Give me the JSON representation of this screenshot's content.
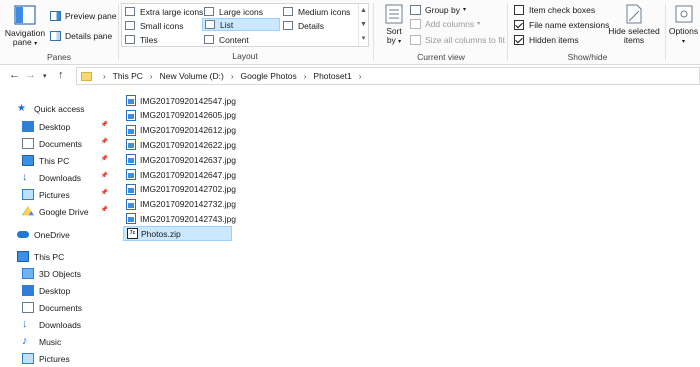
{
  "ribbon": {
    "panes": {
      "group_label": "Panes",
      "navigation_pane_label": "Navigation",
      "navigation_pane_label2": "pane",
      "preview_pane_label": "Preview pane",
      "details_pane_label": "Details pane"
    },
    "layout": {
      "group_label": "Layout",
      "extra_large_icons": "Extra large icons",
      "large_icons": "Large icons",
      "medium_icons": "Medium icons",
      "small_icons": "Small icons",
      "list": "List",
      "details": "Details",
      "tiles": "Tiles",
      "content": "Content",
      "selected": "List"
    },
    "current_view": {
      "group_label": "Current view",
      "sort_by_label": "Sort",
      "sort_by_label2": "by",
      "group_by": "Group by",
      "add_columns": "Add columns",
      "size_all_columns": "Size all columns to fit"
    },
    "show_hide": {
      "group_label": "Show/hide",
      "item_check_boxes": "Item check boxes",
      "item_check_boxes_checked": false,
      "file_name_extensions": "File name extensions",
      "file_name_extensions_checked": true,
      "hidden_items": "Hidden items",
      "hidden_items_checked": true,
      "hide_selected_items": "Hide selected",
      "hide_selected_items2": "items"
    },
    "options": {
      "label": "Options"
    }
  },
  "address_bar": {
    "breadcrumbs": [
      "This PC",
      "New Volume (D:)",
      "Google Photos",
      "Photoset1"
    ]
  },
  "nav_pane": {
    "quick_access": {
      "label": "Quick access",
      "items": [
        {
          "label": "Desktop",
          "icon": "desktop-icon",
          "pinned": true
        },
        {
          "label": "Documents",
          "icon": "documents-icon",
          "pinned": true
        },
        {
          "label": "This PC",
          "icon": "computer-icon",
          "pinned": true
        },
        {
          "label": "Downloads",
          "icon": "downloads-icon",
          "pinned": true
        },
        {
          "label": "Pictures",
          "icon": "pictures-icon",
          "pinned": true
        },
        {
          "label": "Google Drive",
          "icon": "google-drive-icon",
          "pinned": true
        }
      ]
    },
    "onedrive": {
      "label": "OneDrive",
      "icon": "cloud-icon"
    },
    "this_pc": {
      "label": "This PC",
      "items": [
        {
          "label": "3D Objects",
          "icon": "3d-objects-icon"
        },
        {
          "label": "Desktop",
          "icon": "desktop-icon"
        },
        {
          "label": "Documents",
          "icon": "documents-icon"
        },
        {
          "label": "Downloads",
          "icon": "downloads-icon"
        },
        {
          "label": "Music",
          "icon": "music-icon"
        },
        {
          "label": "Pictures",
          "icon": "pictures-icon"
        }
      ]
    }
  },
  "files": [
    {
      "name": "IMG20170920142547.jpg",
      "type": "jpg"
    },
    {
      "name": "IMG20170920142605.jpg",
      "type": "jpg"
    },
    {
      "name": "IMG20170920142612.jpg",
      "type": "jpg"
    },
    {
      "name": "IMG20170920142622.jpg",
      "type": "jpg"
    },
    {
      "name": "IMG20170920142637.jpg",
      "type": "jpg"
    },
    {
      "name": "IMG20170920142647.jpg",
      "type": "jpg"
    },
    {
      "name": "IMG20170920142702.jpg",
      "type": "jpg"
    },
    {
      "name": "IMG20170920142732.jpg",
      "type": "jpg"
    },
    {
      "name": "IMG20170920142743.jpg",
      "type": "jpg"
    },
    {
      "name": "Photos.zip",
      "type": "zip",
      "selected": true,
      "icon_text": "7z"
    }
  ],
  "colors": {
    "selection_bg": "#cce8ff",
    "selection_border": "#99d1ff",
    "folder_yellow": "#f8d775",
    "accent_blue": "#0078d7"
  }
}
